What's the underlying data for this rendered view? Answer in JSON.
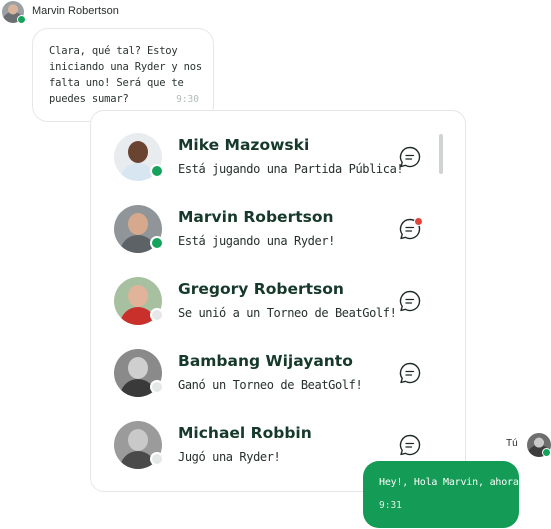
{
  "incoming": {
    "sender": "Marvin Robertson",
    "message": "Clara, qué tal? Estoy iniciando una Ryder y nos falta uno! Será que te puedes sumar?",
    "time": "9:30"
  },
  "friends": [
    {
      "name": "Mike Mazowski",
      "activity": "Está jugando una Partida Pública!",
      "status": "online",
      "unread": false,
      "skin": "#6b4431",
      "shirt": "#d8e6f2",
      "bg": "#e9ecef"
    },
    {
      "name": "Marvin Robertson",
      "activity": "Está jugando una Ryder!",
      "status": "online",
      "unread": true,
      "skin": "#d6a98c",
      "shirt": "#5d6266",
      "bg": "#8f9598"
    },
    {
      "name": "Gregory Robertson",
      "activity": "Se unió a un Torneo de BeatGolf!",
      "status": "offline",
      "unread": false,
      "skin": "#e0b39a",
      "shirt": "#c9302c",
      "bg": "#a7c0a0"
    },
    {
      "name": "Bambang Wijayanto",
      "activity": "Ganó un Torneo de BeatGolf!",
      "status": "offline",
      "unread": false,
      "skin": "#cfcfcf",
      "shirt": "#3a3a3a",
      "bg": "#8a8a8a"
    },
    {
      "name": "Michael Robbin",
      "activity": "Jugó una Ryder!",
      "status": "offline",
      "unread": false,
      "skin": "#c9c9c9",
      "shirt": "#4a4a4a",
      "bg": "#9b9b9b"
    }
  ],
  "outgoing": {
    "sender": "Tú",
    "message": "Hey!, Hola Marvin, ahora?",
    "time": "9:31"
  },
  "colors": {
    "online": "#15a35b",
    "offline": "#e6e8e7",
    "unread": "#e0453d",
    "brand": "#149b55"
  },
  "icons": {
    "chat": "chat-bubble-icon"
  }
}
